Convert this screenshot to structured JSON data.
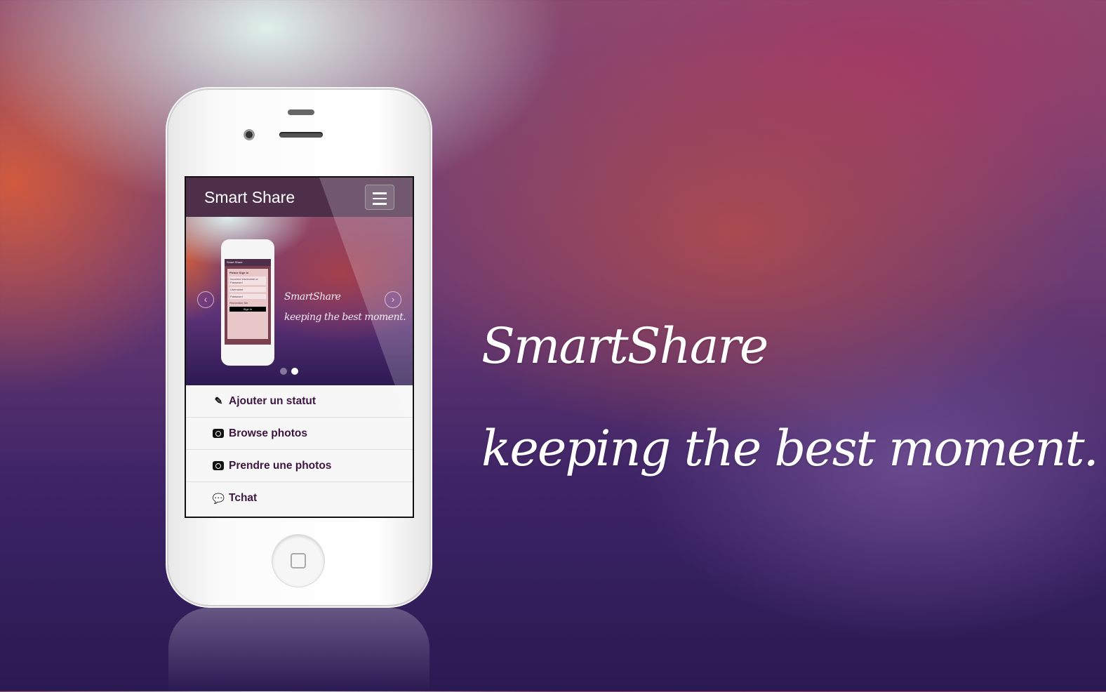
{
  "headline": {
    "title": "SmartShare",
    "tagline": "keeping the best moment."
  },
  "app": {
    "brand": "Smart Share",
    "menu_icon": "hamburger-icon",
    "carousel": {
      "caption_title": "SmartShare",
      "caption_tagline": "keeping the best moment.",
      "prev": "‹",
      "next": "›",
      "active_slide": 2,
      "slide_count": 2,
      "mini_screen": {
        "brand": "Smart Share",
        "heading": "Please Sign In",
        "error": "Incorrect Username or Password",
        "username": "Username",
        "password": "Password",
        "remember": "Remember Me",
        "signin": "Sign In"
      }
    },
    "menu": [
      {
        "label": "Ajouter un statut",
        "icon": "edit-icon"
      },
      {
        "label": "Browse photos",
        "icon": "camera-icon"
      },
      {
        "label": "Prendre une photos",
        "icon": "camera-icon"
      },
      {
        "label": "Tchat",
        "icon": "chat-icon"
      }
    ]
  }
}
